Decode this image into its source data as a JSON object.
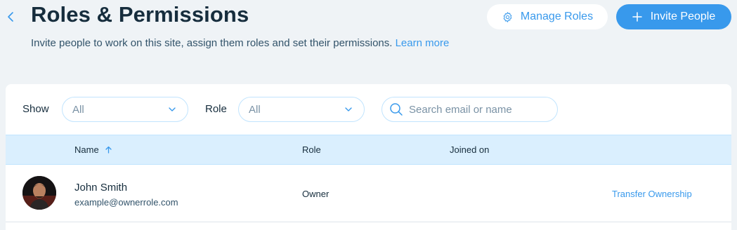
{
  "header": {
    "title": "Roles & Permissions",
    "subtitle": "Invite people to work on this site, assign them roles and set their permissions.",
    "learn_more": "Learn more",
    "manage_roles_label": "Manage Roles",
    "invite_people_label": "Invite People",
    "icons": {
      "back": "chevron-left-icon",
      "manage": "gear-icon",
      "invite": "plus-icon"
    }
  },
  "filters": {
    "show_label": "Show",
    "show_value": "All",
    "role_label": "Role",
    "role_value": "All",
    "search_placeholder": "Search email or name"
  },
  "table": {
    "columns": [
      "Name",
      "Role",
      "Joined on"
    ],
    "sorted_column": "Name",
    "sort_direction": "ascending",
    "rows": [
      {
        "name": "John Smith",
        "email": "example@ownerrole.com",
        "role": "Owner",
        "joined_on": "",
        "action": "Transfer Ownership"
      }
    ]
  },
  "colors": {
    "accent": "#3899ec",
    "background": "#eff3f6",
    "table_header": "#daeffe",
    "text": "#162d3d"
  }
}
